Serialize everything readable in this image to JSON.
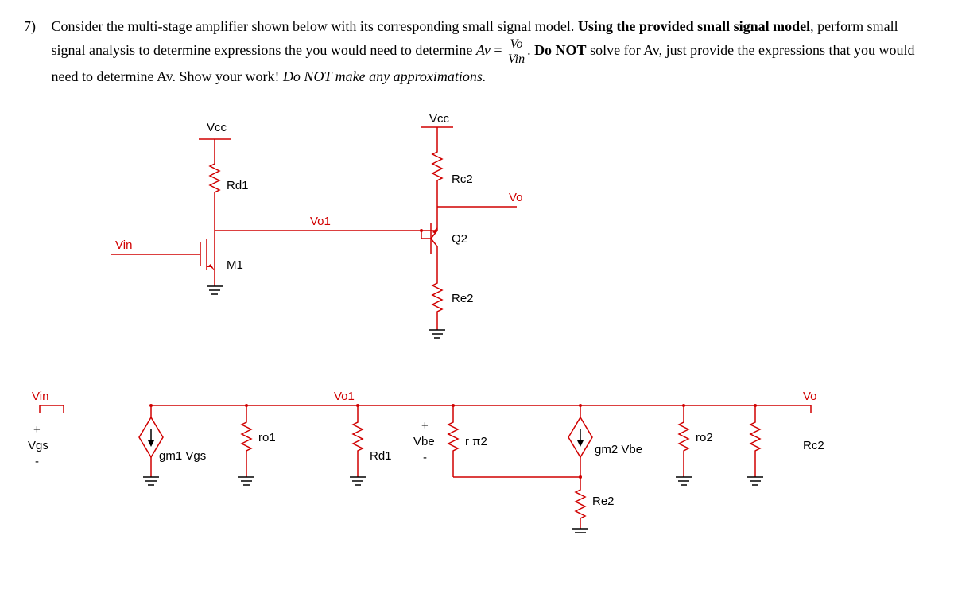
{
  "problem": {
    "number": "7)",
    "text_part1": "Consider the multi-stage amplifier shown below with its corresponding small signal model. ",
    "text_bold1": "Using the provided small signal model",
    "text_part2": ", perform small signal analysis to determine expressions the you would need to determine ",
    "eq_lhs": "Av",
    "frac_num": "Vo",
    "frac_den": "Vin",
    "text_part3": ". ",
    "text_donot": "Do NOT",
    "text_part4": " solve for Av, just provide the expressions that you would need to determine Av. Show your work! ",
    "text_italic_end": "Do NOT make any approximations."
  },
  "schematic": {
    "Vcc1": "Vcc",
    "Vcc2": "Vcc",
    "Rd1": "Rd1",
    "M1": "M1",
    "Vin": "Vin",
    "Vo1": "Vo1",
    "Rc2": "Rc2",
    "Q2": "Q2",
    "Re2": "Re2",
    "Vo": "Vo"
  },
  "smallsignal": {
    "Vin": "Vin",
    "plus": "+",
    "Vgs": "Vgs",
    "minus": "-",
    "gm1Vgs": "gm1 Vgs",
    "ro1": "ro1",
    "Vo1": "Vo1",
    "Rd1": "Rd1",
    "Vbe": "Vbe",
    "rpi2": "r π2",
    "gm2Vbe": "gm2 Vbe",
    "ro2": "ro2",
    "Re2": "Re2",
    "Vo": "Vo",
    "Rc2": "Rc2"
  }
}
